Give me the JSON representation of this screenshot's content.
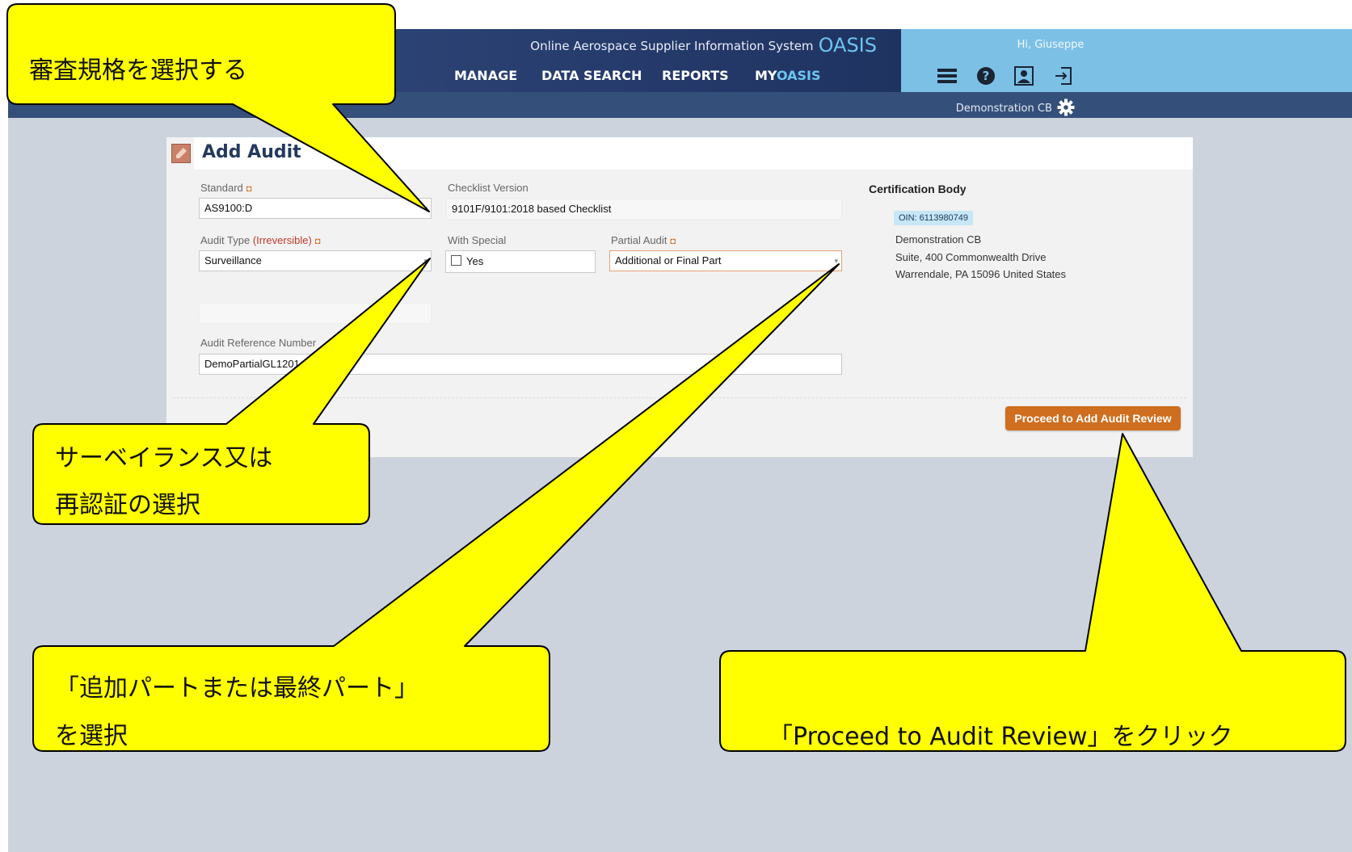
{
  "header": {
    "system_title": "Online Aerospace Supplier Information System",
    "system_name": "OASIS",
    "nav": [
      {
        "label": "MANAGE"
      },
      {
        "label": "DATA SEARCH"
      },
      {
        "label": "REPORTS"
      },
      {
        "label_prefix": "MY",
        "label_suffix": "OASIS"
      }
    ],
    "greeting": "Hi, Giuseppe",
    "icons": [
      "menu-icon",
      "help-icon",
      "user-profile-icon",
      "logout-icon",
      "gear-icon"
    ],
    "certification_body_label": "Demonstration CB"
  },
  "form": {
    "title": "Add Audit",
    "standard": {
      "label": "Standard",
      "required_mark": "◘",
      "value": "AS9100:D"
    },
    "checklist_version": {
      "label": "Checklist Version",
      "value": "9101F/9101:2018 based Checklist"
    },
    "audit_type": {
      "label": "Audit Type",
      "label_note": "(Irreversible)",
      "required_mark": "◘",
      "value": "Surveillance"
    },
    "with_special": {
      "label": "With Special",
      "option": "Yes",
      "checked": false
    },
    "partial_audit": {
      "label": "Partial Audit",
      "required_mark": "◘",
      "value": "Additional or Final Part"
    },
    "audit_reference": {
      "label": "Audit Reference Number",
      "value": "DemoPartialGL1201"
    },
    "certification_body": {
      "title": "Certification Body",
      "oin": "OIN: 6113980749",
      "name": "Demonstration CB",
      "address_line1": "Suite, 400 Commonwealth Drive",
      "address_line2": "Warrendale, PA 15096 United States"
    },
    "proceed_button": "Proceed to Add Audit Review"
  },
  "callouts": {
    "standard": "審査規格を選択する",
    "audit_type_line1": "サーベイランス又は",
    "audit_type_line2": "再認証の選択",
    "partial_line1": "「追加パートまたは最終パート」",
    "partial_line2": "を選択",
    "proceed": "「Proceed to Audit Review」をクリック"
  },
  "colors": {
    "callout_fill": "#ffff00",
    "header_dark": "#1f3361",
    "header_light": "#7cc0e6",
    "button_orange": "#cf6e1f",
    "page_background": "#ccd3dd"
  }
}
